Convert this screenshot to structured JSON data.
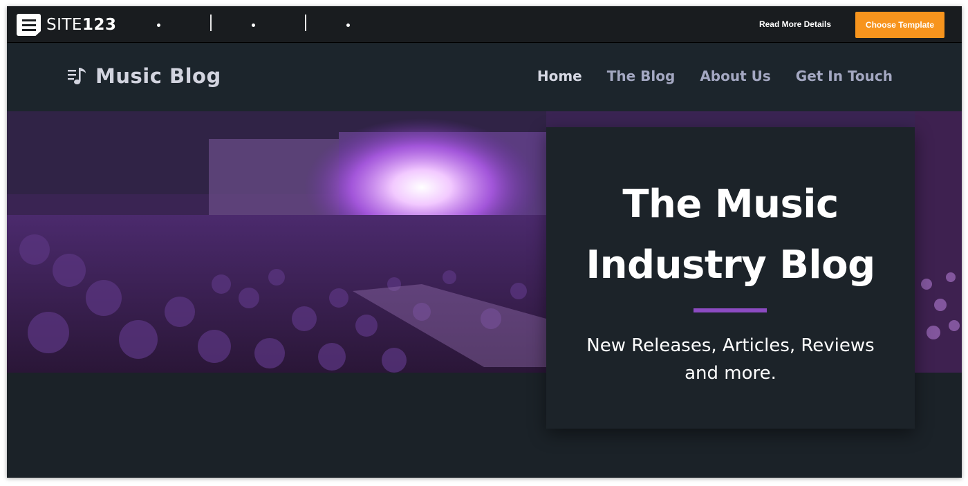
{
  "builder_bar": {
    "logo_text_light": "SITE",
    "logo_text_bold": "123",
    "read_more_label": "Read More Details",
    "choose_template_label": "Choose Template",
    "accent_color": "#f7941d"
  },
  "site": {
    "brand_name": "Music Blog",
    "brand_icon": "music-note-list-icon",
    "nav": [
      {
        "label": "Home",
        "active": true
      },
      {
        "label": "The Blog",
        "active": false
      },
      {
        "label": "About Us",
        "active": false
      },
      {
        "label": "Get In Touch",
        "active": false
      }
    ]
  },
  "hero": {
    "image_subject": "concert crowd",
    "title_line1": "The Music",
    "title_line2": "Industry Blog",
    "subtitle_line1": "New Releases, Articles, Reviews",
    "subtitle_line2": "and more.",
    "rule_color": "#8c4bc2"
  }
}
